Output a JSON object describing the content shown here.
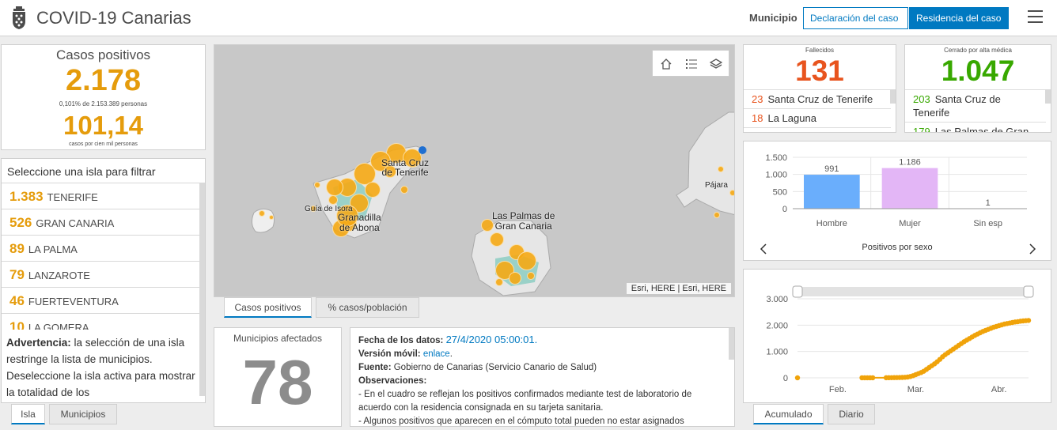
{
  "header": {
    "title": "COVID-19 Canarias",
    "municipio_label": "Municipio",
    "btn_declaracion": "Declaración del caso",
    "btn_residencia": "Residencia del caso"
  },
  "casos": {
    "title": "Casos positivos",
    "value": "2.178",
    "pct_text": "0,101% de 2.153.389 personas",
    "rate": "101,14",
    "rate_label": "casos por cien mil personas"
  },
  "islas": {
    "title": "Seleccione una isla para filtrar",
    "items": [
      {
        "count": "1.383",
        "name": "TENERIFE"
      },
      {
        "count": "526",
        "name": "GRAN CANARIA"
      },
      {
        "count": "89",
        "name": "LA PALMA"
      },
      {
        "count": "79",
        "name": "LANZAROTE"
      },
      {
        "count": "46",
        "name": "FUERTEVENTURA"
      },
      {
        "count": "10",
        "name": "LA GOMERA"
      }
    ],
    "warning_bold": "Advertencia:",
    "warning_text": " la selección de una isla restringe la lista de municipios. Deseleccione la isla activa para mostrar la totalidad de los",
    "tab_isla": "Isla",
    "tab_municipios": "Municipios"
  },
  "map": {
    "labels": {
      "santa_cruz_1": "Santa Cruz",
      "santa_cruz_2": "de Tenerife",
      "guia": "Guía de Isora",
      "granadilla_1": "Granadilla",
      "granadilla_2": "de Abona",
      "las_palmas_1": "Las Palmas de",
      "las_palmas_2": "Gran Canaria",
      "pajara": "Pájara"
    },
    "attribution": "Esri, HERE | Esri, HERE",
    "tab_casos": "Casos positivos",
    "tab_pct": "% casos/población"
  },
  "municipios": {
    "label": "Municipios afectados",
    "value": "78"
  },
  "info": {
    "fecha_label": "Fecha de los datos:",
    "fecha_value": "27/4/2020 05:00:01.",
    "version_label": "Versión móvil:",
    "version_link": "enlace",
    "fuente_label": "Fuente:",
    "fuente_value": "Gobierno de Canarias (Servicio Canario de Salud)",
    "obs_label": "Observaciones:",
    "obs1": "- En el cuadro se reflejan los positivos confirmados mediante test de laboratorio de acuerdo con la residencia consignada en su tarjeta sanitaria.",
    "obs2": "- Algunos positivos que aparecen en el cómputo total pueden no estar asignados"
  },
  "fallecidos": {
    "title": "Fallecidos",
    "value": "131",
    "rows": [
      {
        "count": "23",
        "name": "Santa Cruz de Tenerife"
      },
      {
        "count": "18",
        "name": "La Laguna"
      }
    ],
    "color": "#e8541e"
  },
  "cerrado": {
    "title": "Cerrado por alta médica",
    "value": "1.047",
    "rows": [
      {
        "count": "203",
        "name": "Santa Cruz de Tenerife"
      },
      {
        "count": "179",
        "name": "Las Palmas de Gran Canaria"
      }
    ],
    "color": "#38a800"
  },
  "chart_data": [
    {
      "type": "bar",
      "title": "Positivos por sexo",
      "categories": [
        "Hombre",
        "Mujer",
        "Sin esp"
      ],
      "values": [
        991,
        1186,
        1
      ],
      "value_labels": [
        "991",
        "1.186",
        "1"
      ],
      "colors": [
        "#6aaefc",
        "#e3b6f6",
        "#cccccc"
      ],
      "ylim": [
        0,
        1500
      ],
      "yticks": [
        0,
        500,
        1000,
        1500
      ],
      "ytick_labels": [
        "0",
        "500",
        "1.000",
        "1.500"
      ],
      "grid": true
    },
    {
      "type": "line",
      "title": "",
      "xtick_labels": [
        "Feb.",
        "Mar.",
        "Abr."
      ],
      "ylim": [
        0,
        3000
      ],
      "yticks": [
        0,
        1000,
        2000,
        3000
      ],
      "ytick_labels": [
        "0",
        "1.000",
        "2.000",
        "3.000"
      ],
      "color": "#f0a30a",
      "x_dates": [
        "2020-01-31",
        "2020-02-24",
        "2020-02-25",
        "2020-02-26",
        "2020-02-27",
        "2020-02-28",
        "2020-03-04",
        "2020-03-05",
        "2020-03-06",
        "2020-03-07",
        "2020-03-08",
        "2020-03-09",
        "2020-03-10",
        "2020-03-11",
        "2020-03-12",
        "2020-03-13",
        "2020-03-14",
        "2020-03-15",
        "2020-03-16",
        "2020-03-17",
        "2020-03-18",
        "2020-03-19",
        "2020-03-20",
        "2020-03-21",
        "2020-03-22",
        "2020-03-23",
        "2020-03-24",
        "2020-03-25",
        "2020-03-26",
        "2020-03-27",
        "2020-03-28",
        "2020-03-29",
        "2020-03-30",
        "2020-03-31",
        "2020-04-01",
        "2020-04-02",
        "2020-04-03",
        "2020-04-04",
        "2020-04-05",
        "2020-04-06",
        "2020-04-07",
        "2020-04-08",
        "2020-04-09",
        "2020-04-10",
        "2020-04-11",
        "2020-04-12",
        "2020-04-13",
        "2020-04-14",
        "2020-04-15",
        "2020-04-16",
        "2020-04-17",
        "2020-04-18",
        "2020-04-19",
        "2020-04-20",
        "2020-04-21",
        "2020-04-22",
        "2020-04-23",
        "2020-04-24",
        "2020-04-25",
        "2020-04-26"
      ],
      "values": [
        1,
        2,
        2,
        2,
        2,
        2,
        4,
        6,
        7,
        8,
        10,
        12,
        15,
        20,
        30,
        50,
        80,
        120,
        160,
        200,
        250,
        320,
        390,
        460,
        530,
        610,
        700,
        800,
        880,
        950,
        1020,
        1090,
        1160,
        1230,
        1300,
        1370,
        1430,
        1490,
        1550,
        1610,
        1660,
        1710,
        1760,
        1800,
        1840,
        1880,
        1920,
        1950,
        1980,
        2010,
        2040,
        2060,
        2080,
        2100,
        2120,
        2130,
        2150,
        2160,
        2170,
        2178
      ],
      "tab_acumulado": "Acumulado",
      "tab_diario": "Diario"
    }
  ]
}
